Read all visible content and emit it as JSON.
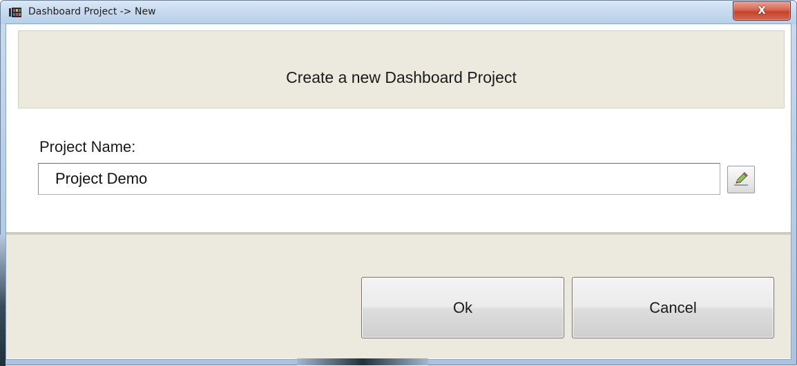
{
  "window": {
    "title": "Dashboard Project -> New",
    "close_label": "X"
  },
  "header": {
    "text": "Create a new Dashboard Project"
  },
  "form": {
    "project_name_label": "Project Name:",
    "project_name_value": "Project Demo",
    "edit_icon": "pencil-icon"
  },
  "buttons": {
    "ok_label": "Ok",
    "cancel_label": "Cancel"
  },
  "colors": {
    "panel_bg": "#ece9df",
    "close_button": "#c4432c",
    "title_bar": "#c6d9ee"
  }
}
